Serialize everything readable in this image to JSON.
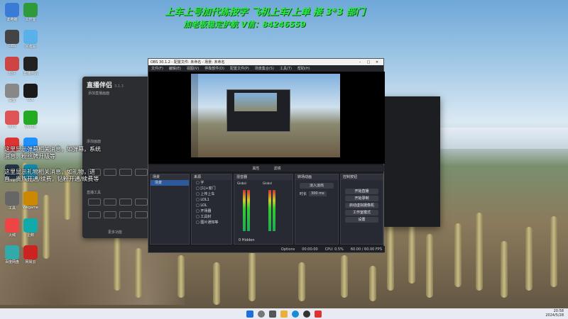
{
  "banner": {
    "line1": "上车上号加代练按字 飞机上车/上单 接 3*3 部门",
    "line2": "加老板稳定护航 V信：84246559"
  },
  "overlay_text": {
    "line1": "这里显示弹幕相关消息，如弹幕，系统",
    "line2": "消息，粉丝牌升级等",
    "line3": "这里显示礼物相关消息，如礼物，进",
    "line4": "直，贵族开通/续费，钻粉开通/续费等"
  },
  "side_panel": {
    "title": "直播伴侣",
    "version": "3.1.3",
    "subtitle": "添加直播画面",
    "section1": "添加画面",
    "section2": "直播工具",
    "section3": "更多功能"
  },
  "obs": {
    "window_title": "OBS 30.1.2 - 配置文件: 未命名 - 场景: 未命名",
    "menu": [
      "文件(F)",
      "编辑(E)",
      "视图(V)",
      "停靠部件(D)",
      "配置文件(P)",
      "场景集合(S)",
      "工具(T)",
      "帮助(H)"
    ],
    "scene_bar": [
      "属性",
      "滤镜"
    ],
    "docks": {
      "scenes": {
        "title": "场景",
        "items": [
          "场景"
        ]
      },
      "sources": {
        "title": "来源",
        "items": [
          "字",
          "[1]+窗门",
          "上传上车",
          "LOL1",
          "LOL",
          "开场器",
          "工具封",
          "图片通知等"
        ]
      },
      "mixer": {
        "title": "混音器",
        "channels": [
          "Global",
          "Global"
        ],
        "labels": [
          "桌面音频",
          "麦克风/Aux"
        ]
      },
      "transitions": {
        "title": "转场动画",
        "type": "淡入淡出",
        "duration_label": "时长",
        "duration": "300 ms"
      },
      "controls": {
        "title": "控制按钮",
        "buttons": [
          "开始直播",
          "开始录制",
          "启动虚拟摄像机",
          "工作室模式",
          "设置"
        ]
      }
    },
    "mixer_tab": "0 Hidden",
    "options": "Options",
    "status": {
      "recording": "00:00:00",
      "cpu": "CPU: 0.5%",
      "fps": "60.00 / 60.00 FPS"
    }
  },
  "taskbar": {
    "time": "20:58",
    "date": "2024/5/28"
  },
  "desktop_icons": [
    "此电脑",
    "工作室",
    "OBS",
    "回收站",
    "软件",
    "直播伴侣",
    "设置",
    "LOL",
    "WPS",
    "Nvidia",
    "网易",
    "QQ",
    "Steam",
    "Edge",
    "工具",
    "Wegame",
    "火绒",
    "企鹅",
    "百度网盘",
    "网易云"
  ]
}
